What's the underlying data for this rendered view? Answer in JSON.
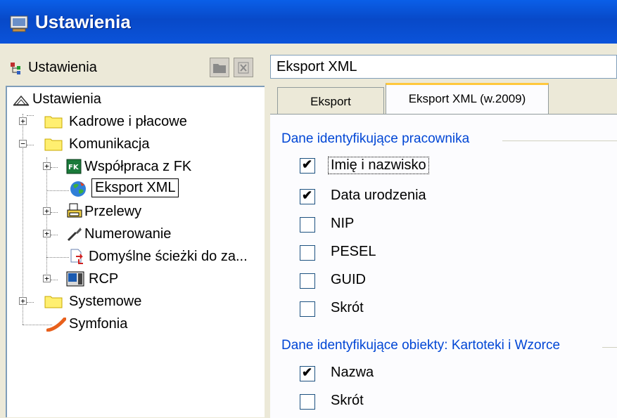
{
  "window": {
    "title": "Ustawienia",
    "icon": "window-icon"
  },
  "left": {
    "header": "Ustawienia",
    "tree": [
      {
        "label": "Ustawienia",
        "icon": "hierarchy-icon"
      },
      {
        "label": "Kadrowe i płacowe",
        "icon": "folder-icon"
      },
      {
        "label": "Komunikacja",
        "icon": "folder-icon"
      },
      {
        "label": "Współpraca z FK",
        "icon": "fk-icon"
      },
      {
        "label": "Eksport XML",
        "icon": "globe-icon"
      },
      {
        "label": "Przelewy",
        "icon": "printer-icon"
      },
      {
        "label": "Numerowanie",
        "icon": "wrench-icon"
      },
      {
        "label": "Domyślne ścieżki do za...",
        "icon": "document-arrow-icon"
      },
      {
        "label": "RCP",
        "icon": "rcp-icon"
      },
      {
        "label": "Systemowe",
        "icon": "folder-icon"
      },
      {
        "label": "Symfonia",
        "icon": "symfonia-icon"
      }
    ]
  },
  "right": {
    "address": "Eksport XML",
    "tabs": [
      "Eksport",
      "Eksport XML (w.2009)"
    ],
    "group1": {
      "title": "Dane identyfikujące pracownika",
      "items": [
        {
          "label": "Imię i nazwisko",
          "checked": true
        },
        {
          "label": "Data urodzenia",
          "checked": true
        },
        {
          "label": "NIP",
          "checked": false
        },
        {
          "label": "PESEL",
          "checked": false
        },
        {
          "label": "GUID",
          "checked": false
        },
        {
          "label": "Skrót",
          "checked": false
        }
      ]
    },
    "group2": {
      "title": "Dane identyfikujące obiekty: Kartoteki i Wzorce",
      "items": [
        {
          "label": "Nazwa",
          "checked": true
        },
        {
          "label": "Skrót",
          "checked": false
        }
      ]
    }
  },
  "colors": {
    "titlebar": "#0a53da",
    "group_title": "#0046d5",
    "tab_highlight": "#ffc83c",
    "background": "#ece9d8"
  }
}
